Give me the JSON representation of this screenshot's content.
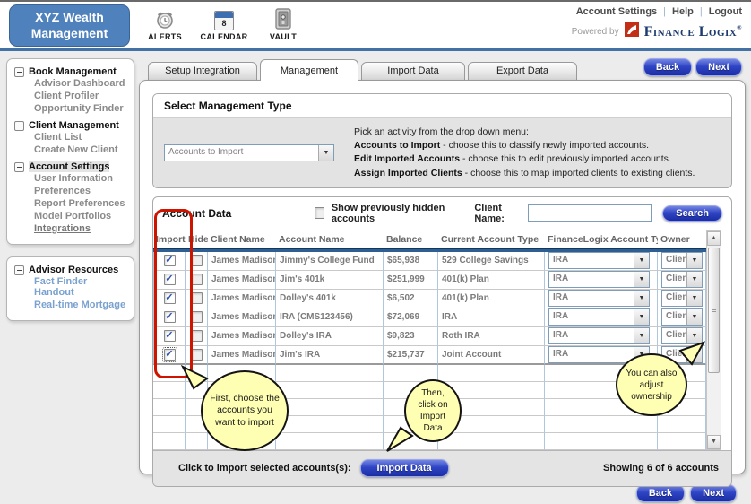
{
  "header": {
    "logo_line1": "XYZ Wealth",
    "logo_line2": "Management",
    "icons": [
      {
        "name": "alerts",
        "label": "ALERTS"
      },
      {
        "name": "calendar",
        "label": "CALENDAR",
        "day": "8"
      },
      {
        "name": "vault",
        "label": "VAULT"
      }
    ],
    "links": [
      "Account Settings",
      "Help",
      "Logout"
    ],
    "powered_by": "Powered by",
    "brand": "Finance Logix",
    "brand_reg": "®"
  },
  "sidebar": {
    "sections": [
      {
        "title": "Book Management",
        "items": [
          "Advisor Dashboard",
          "Client Profiler",
          "Opportunity Finder"
        ]
      },
      {
        "title": "Client Management",
        "items": [
          "Client List",
          "Create New Client"
        ]
      },
      {
        "title": "Account Settings",
        "items": [
          "User Information",
          "Preferences",
          "Report Preferences",
          "Model Portfolios",
          "Integrations"
        ]
      }
    ],
    "resources": {
      "title": "Advisor Resources",
      "items": [
        "Fact Finder Handout",
        "Real-time Mortgage"
      ]
    }
  },
  "tabs": [
    {
      "label": "Setup Integration"
    },
    {
      "label": "Management"
    },
    {
      "label": "Import Data"
    },
    {
      "label": "Export Data"
    }
  ],
  "buttons": {
    "back": "Back",
    "next": "Next"
  },
  "management_type": {
    "title": "Select Management Type",
    "dropdown_value": "Accounts to Import",
    "intro": "Pick an activity from the drop down menu:",
    "options": [
      {
        "name": "Accounts to Import",
        "desc": " - choose this to classify newly imported accounts."
      },
      {
        "name": "Edit Imported Accounts",
        "desc": " - choose this to edit previously imported accounts."
      },
      {
        "name": "Assign Imported Clients",
        "desc": " - choose this to map imported clients to existing clients."
      }
    ]
  },
  "account_data": {
    "title": "Account Data",
    "show_hidden_label": "Show previously hidden accounts",
    "show_hidden_checked": false,
    "client_name_label": "Client Name:",
    "client_name_value": "",
    "search_label": "Search",
    "columns": [
      "Import",
      "Hide",
      "Client Name",
      "Account Name",
      "Balance",
      "Current Account Type",
      "FinanceLogix Account Type",
      "Owner"
    ],
    "rows": [
      {
        "import": true,
        "hide": false,
        "client": "James Madison",
        "account": "Jimmy's College Fund",
        "balance": "$65,938",
        "current_type": "529 College Savings",
        "fl_type": "IRA",
        "owner": "Client"
      },
      {
        "import": true,
        "hide": false,
        "client": "James Madison",
        "account": "Jim's 401k",
        "balance": "$251,999",
        "current_type": "401(k) Plan",
        "fl_type": "IRA",
        "owner": "Client"
      },
      {
        "import": true,
        "hide": false,
        "client": "James Madison",
        "account": "Dolley's 401k",
        "balance": "$6,502",
        "current_type": "401(k) Plan",
        "fl_type": "IRA",
        "owner": "Client"
      },
      {
        "import": true,
        "hide": false,
        "client": "James Madison",
        "account": "IRA (CMS123456)",
        "balance": "$72,069",
        "current_type": "IRA",
        "fl_type": "IRA",
        "owner": "Client"
      },
      {
        "import": true,
        "hide": false,
        "client": "James Madison",
        "account": "Dolley's IRA",
        "balance": "$9,823",
        "current_type": "Roth IRA",
        "fl_type": "IRA",
        "owner": "Client"
      },
      {
        "import": true,
        "hide": false,
        "client": "James Madison",
        "account": "Jim's IRA",
        "balance": "$215,737",
        "current_type": "Joint Account",
        "fl_type": "IRA",
        "owner": "Client"
      }
    ],
    "footer": {
      "import_prompt": "Click to import selected accounts(s):",
      "import_button": "Import Data",
      "showing": "Showing 6 of 6 accounts"
    }
  },
  "callouts": [
    {
      "text": "First, choose the accounts you want to import"
    },
    {
      "text": "Then, click on Import Data"
    },
    {
      "text": "You can also adjust ownership"
    }
  ]
}
